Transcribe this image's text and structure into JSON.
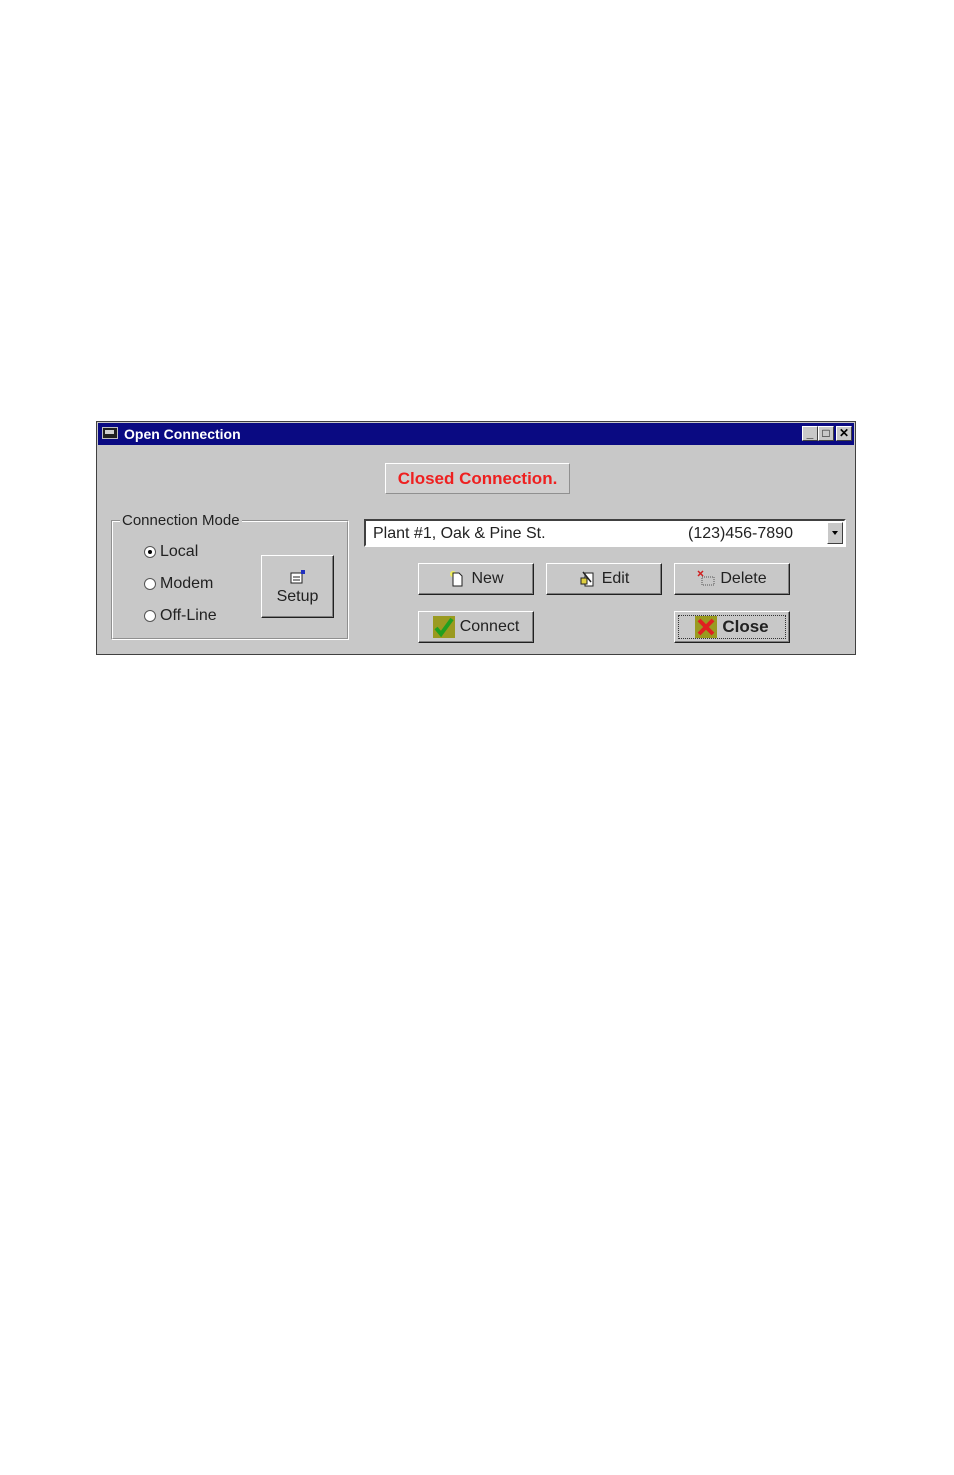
{
  "window": {
    "title": "Open Connection",
    "controls": [
      "minimize",
      "maximize",
      "close"
    ]
  },
  "status": {
    "text": "Closed Connection.",
    "color": "#ee2020"
  },
  "connection_mode": {
    "label": "Connection Mode",
    "options": [
      {
        "label": "Local",
        "selected": true
      },
      {
        "label": "Modem",
        "selected": false
      },
      {
        "label": "Off-Line",
        "selected": false
      }
    ],
    "setup_label": "Setup"
  },
  "connection_select": {
    "name": "Plant #1, Oak & Pine St.",
    "phone": "(123)456-7890"
  },
  "buttons": {
    "new": "New",
    "edit": "Edit",
    "delete": "Delete",
    "connect": "Connect",
    "close": "Close"
  }
}
